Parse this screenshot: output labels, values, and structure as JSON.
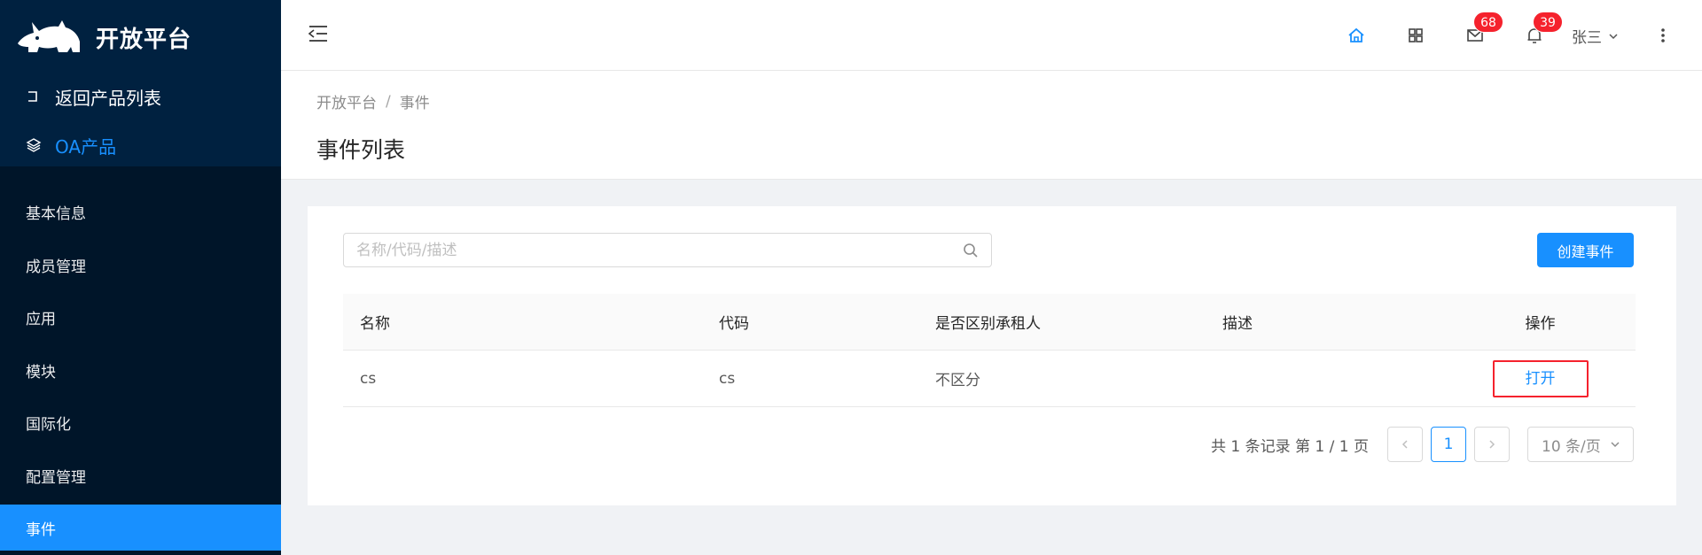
{
  "sidebar": {
    "logo_text": "开放平台",
    "back_label": "返回产品列表",
    "product_label": "OA产品",
    "items": [
      {
        "label": "基本信息",
        "active": false
      },
      {
        "label": "成员管理",
        "active": false
      },
      {
        "label": "应用",
        "active": false
      },
      {
        "label": "模块",
        "active": false
      },
      {
        "label": "国际化",
        "active": false
      },
      {
        "label": "配置管理",
        "active": false
      },
      {
        "label": "事件",
        "active": true
      }
    ]
  },
  "header": {
    "mail_count": "68",
    "notify_count": "39",
    "user_name": "张三"
  },
  "breadcrumb": {
    "root": "开放平台",
    "separator": "/",
    "current": "事件"
  },
  "page_title": "事件列表",
  "search": {
    "placeholder": "名称/代码/描述",
    "value": ""
  },
  "create_button": "创建事件",
  "table": {
    "columns": [
      "名称",
      "代码",
      "是否区别承租人",
      "描述",
      "操作"
    ],
    "rows": [
      {
        "name": "cs",
        "code": "cs",
        "tenant": "不区分",
        "desc": "",
        "action": "打开"
      }
    ]
  },
  "pagination": {
    "total_text": "共 1 条记录 第 1 / 1 页",
    "current_page": "1",
    "page_size": "10 条/页"
  },
  "colors": {
    "accent": "#1890ff",
    "sidebar": "#001529",
    "badge": "#f5222d"
  }
}
